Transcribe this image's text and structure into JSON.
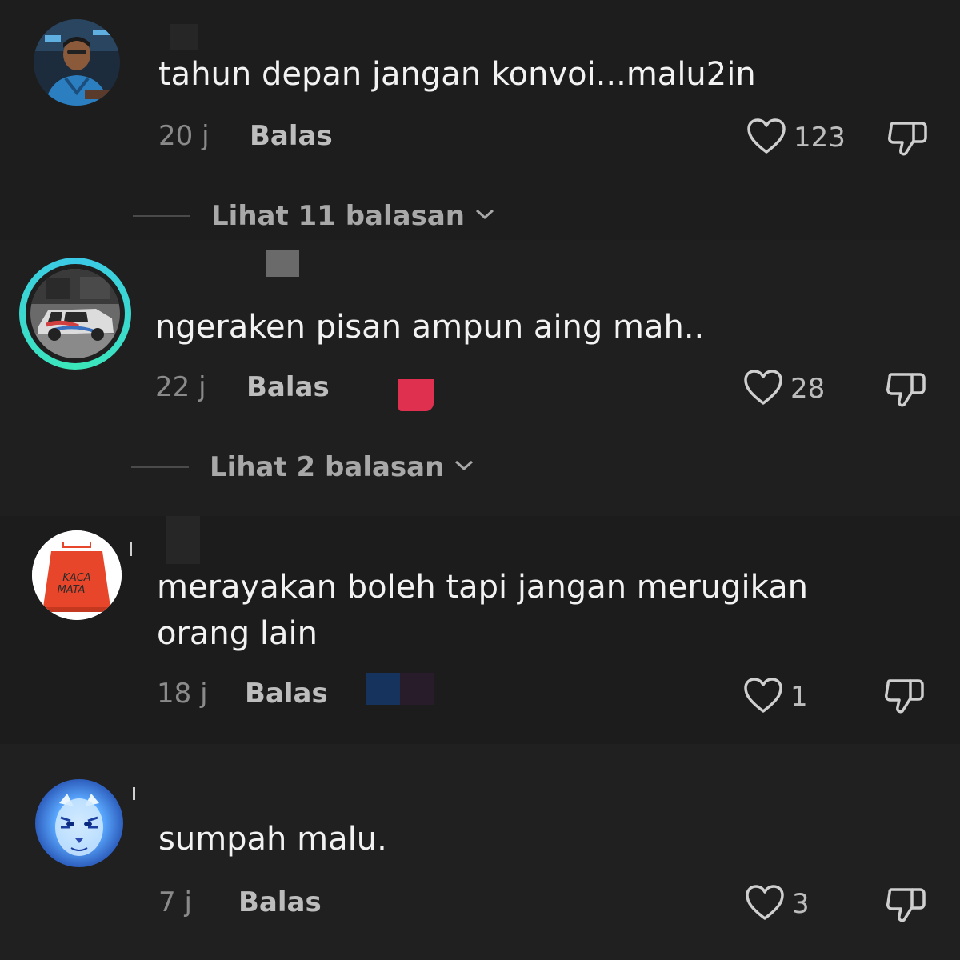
{
  "comments": [
    {
      "text": "tahun depan jangan konvoi...malu2in",
      "time": "20 j",
      "reply_label": "Balas",
      "likes": "123",
      "view_replies": "Lihat 11 balasan"
    },
    {
      "text": "ngeraken pisan ampun aing mah..",
      "time": "22 j",
      "reply_label": "Balas",
      "likes": "28",
      "view_replies": "Lihat 2 balasan"
    },
    {
      "text_line1": "merayakan boleh tapi jangan merugikan",
      "text_line2": "orang lain",
      "time": "18 j",
      "reply_label": "Balas",
      "likes": "1",
      "avatar_text_line1": "KACA",
      "avatar_text_line2": "MATA"
    },
    {
      "text": "sumpah malu.",
      "time": "7 j",
      "reply_label": "Balas",
      "likes": "3"
    }
  ],
  "colors": {
    "background": "#1f1f1f",
    "text": "#f2f2f2",
    "meta": "#8a8a8a",
    "story_ring": "#3bc9e8",
    "avatar3_bg": "#e8462a"
  },
  "icons": {
    "like": "heart-outline-icon",
    "dislike": "thumbs-down-icon",
    "expand": "chevron-down-icon"
  }
}
